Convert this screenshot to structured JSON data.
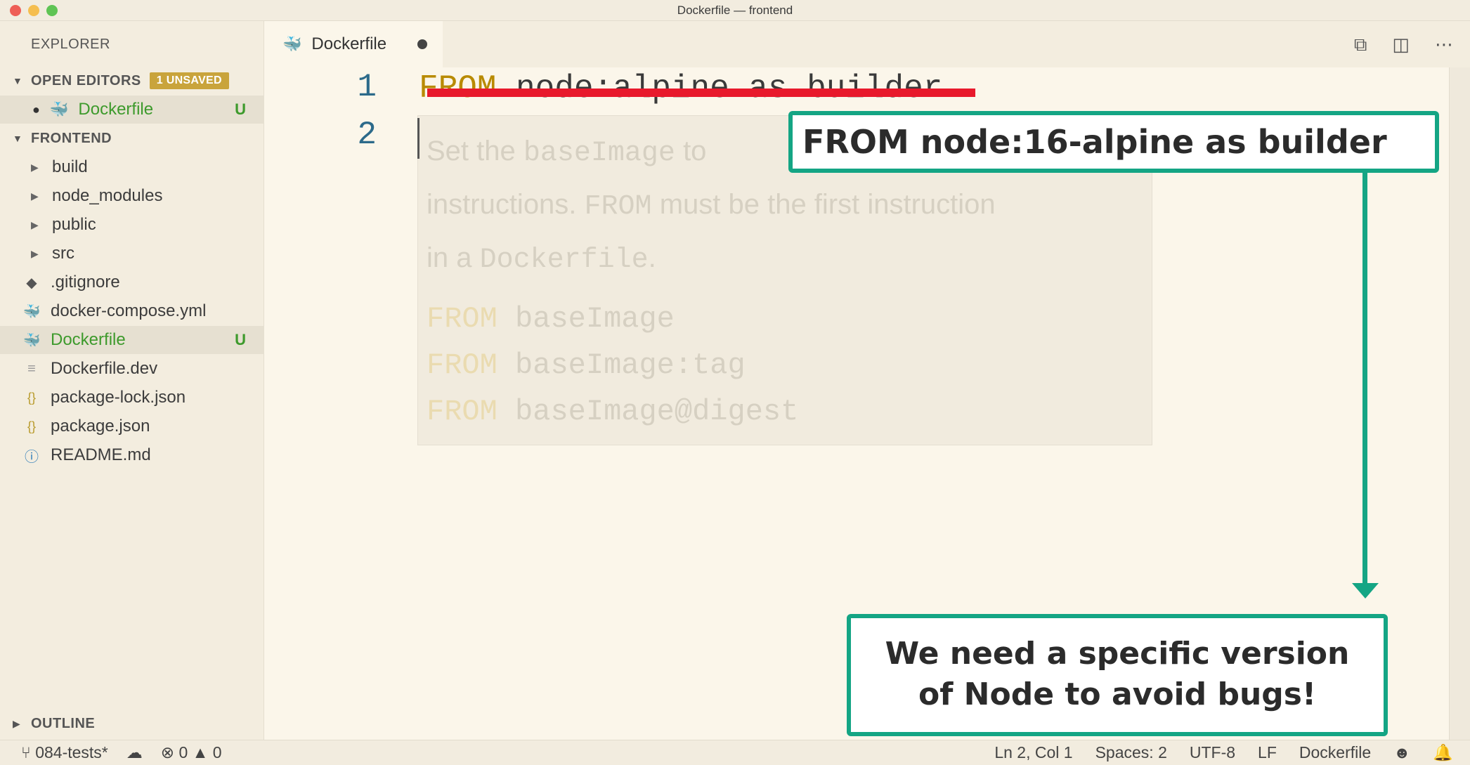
{
  "window": {
    "title": "Dockerfile — frontend"
  },
  "sidebar": {
    "title": "EXPLORER",
    "open_editors": {
      "label": "OPEN EDITORS",
      "badge": "1 UNSAVED",
      "items": [
        {
          "name": "Dockerfile",
          "status": "U"
        }
      ]
    },
    "project": {
      "label": "FRONTEND",
      "folders": [
        "build",
        "node_modules",
        "public",
        "src"
      ],
      "files": [
        {
          "name": ".gitignore",
          "icon": "git-icon",
          "status": ""
        },
        {
          "name": "docker-compose.yml",
          "icon": "docker-icon",
          "status": ""
        },
        {
          "name": "Dockerfile",
          "icon": "docker-icon",
          "status": "U"
        },
        {
          "name": "Dockerfile.dev",
          "icon": "file-lines-icon",
          "status": ""
        },
        {
          "name": "package-lock.json",
          "icon": "json-braces-icon",
          "status": ""
        },
        {
          "name": "package.json",
          "icon": "json-braces-icon",
          "status": ""
        },
        {
          "name": "README.md",
          "icon": "info-icon",
          "status": ""
        }
      ]
    },
    "outline": {
      "label": "OUTLINE"
    }
  },
  "editor": {
    "tab": {
      "label": "Dockerfile"
    },
    "lines": [
      {
        "number": "1",
        "keyword": "FROM",
        "rest": " node:alpine as builder"
      },
      {
        "number": "2"
      }
    ],
    "hover": {
      "line1_a": "Set the",
      "line1_code": "baseImage",
      "line1_b": "to",
      "line2_a": "instructions.",
      "line2_code": "FROM",
      "line2_b": "must be the first instruction",
      "line3_a": "in a",
      "line3_code": "Dockerfile",
      "line3_b": ".",
      "examples": [
        {
          "kw": "FROM",
          "arg": "baseImage"
        },
        {
          "kw": "FROM",
          "arg": "baseImage:tag"
        },
        {
          "kw": "FROM",
          "arg": "baseImage@digest"
        }
      ]
    }
  },
  "annotations": {
    "replacement": "FROM node:16-alpine as builder",
    "note_line1": "We need a specific version",
    "note_line2": "of Node to avoid bugs!"
  },
  "statusbar": {
    "branch": "084-tests*",
    "errors": "0",
    "warnings": "0",
    "position": "Ln 2, Col 1",
    "spaces": "Spaces: 2",
    "encoding": "UTF-8",
    "eol": "LF",
    "language": "Dockerfile"
  },
  "colors": {
    "accent_green": "#14a584",
    "strike_red": "#e8192c",
    "git_untracked": "#3d9a2c",
    "badge": "#c9a43c"
  }
}
